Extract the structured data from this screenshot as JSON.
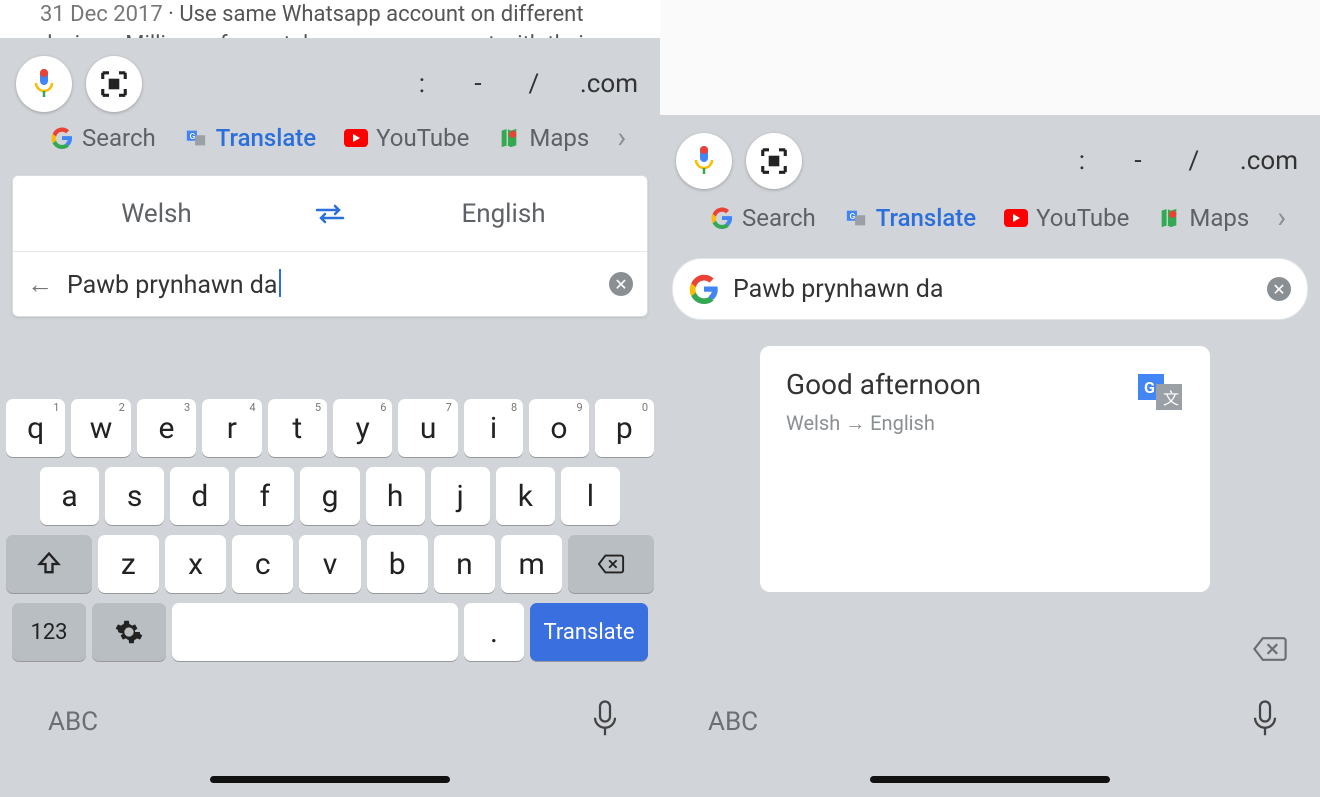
{
  "left": {
    "snippet_date": "31 Dec 2017",
    "snippet_sep": " · ",
    "snippet_text": "Use same Whatsapp account on different devices: Millions of smartphone users connect with their",
    "punct": {
      "colon": ":",
      "dash": "-",
      "slash": "/",
      "dotcom": ".com"
    },
    "chips": {
      "search": "Search",
      "translate": "Translate",
      "youtube": "YouTube",
      "maps": "Maps"
    },
    "lang_from": "Welsh",
    "lang_to": "English",
    "input_text": "Pawb prynhawn da",
    "keys_r1": [
      {
        "ch": "q",
        "n": "1"
      },
      {
        "ch": "w",
        "n": "2"
      },
      {
        "ch": "e",
        "n": "3"
      },
      {
        "ch": "r",
        "n": "4"
      },
      {
        "ch": "t",
        "n": "5"
      },
      {
        "ch": "y",
        "n": "6"
      },
      {
        "ch": "u",
        "n": "7"
      },
      {
        "ch": "i",
        "n": "8"
      },
      {
        "ch": "o",
        "n": "9"
      },
      {
        "ch": "p",
        "n": "0"
      }
    ],
    "keys_r2": [
      "a",
      "s",
      "d",
      "f",
      "g",
      "h",
      "j",
      "k",
      "l"
    ],
    "keys_r3": [
      "z",
      "x",
      "c",
      "v",
      "b",
      "n",
      "m"
    ],
    "k_123": "123",
    "k_dot": ".",
    "k_translate": "Translate",
    "abc": "ABC"
  },
  "right": {
    "punct": {
      "colon": ":",
      "dash": "-",
      "slash": "/",
      "dotcom": ".com"
    },
    "chips": {
      "search": "Search",
      "translate": "Translate",
      "youtube": "YouTube",
      "maps": "Maps"
    },
    "search_text": "Pawb prynhawn da",
    "result_text": "Good afternoon",
    "result_langs": "Welsh → English",
    "abc": "ABC"
  }
}
